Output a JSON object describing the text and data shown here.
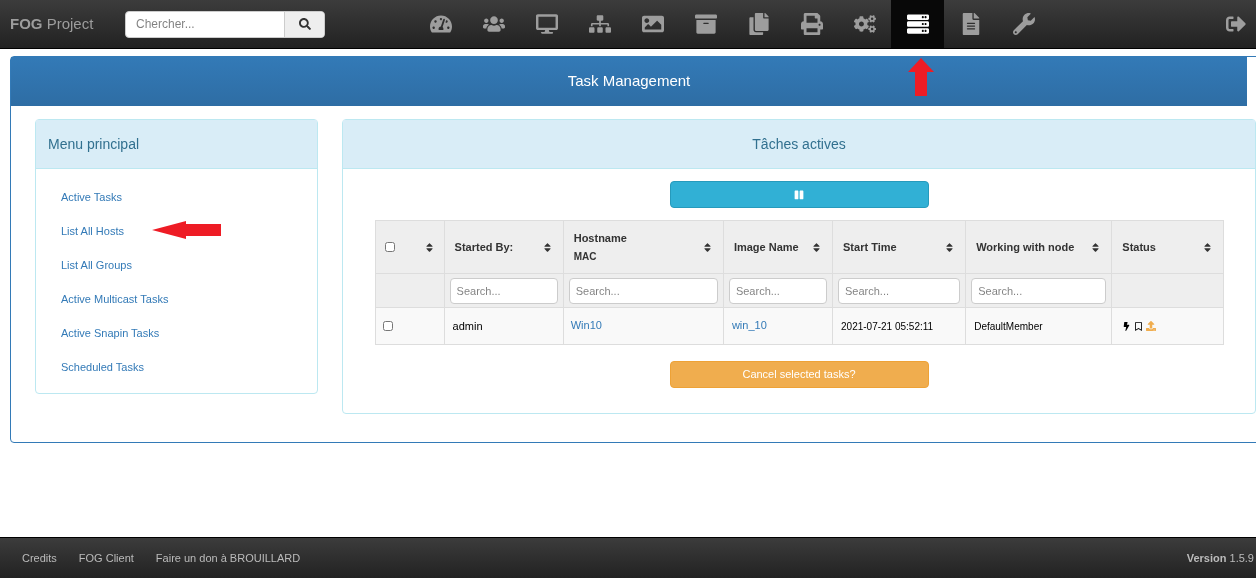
{
  "navbar": {
    "brand": "**FOG** Project",
    "search": {
      "placeholder": "Chercher..."
    },
    "icons": [
      {
        "kind": "dashboard",
        "selected": false
      },
      {
        "kind": "users",
        "selected": false
      },
      {
        "kind": "desktop",
        "selected": false
      },
      {
        "kind": "sitemap",
        "selected": false
      },
      {
        "kind": "image",
        "selected": false
      },
      {
        "kind": "archive",
        "selected": false
      },
      {
        "kind": "copy",
        "selected": false
      },
      {
        "kind": "printer",
        "selected": false
      },
      {
        "kind": "gears",
        "selected": false
      },
      {
        "kind": "tasks",
        "selected": true
      },
      {
        "kind": "file",
        "selected": false
      },
      {
        "kind": "wrench",
        "selected": false
      }
    ]
  },
  "page": {
    "title": "Task Management",
    "menu": {
      "title": "Menu principal",
      "items": [
        "Active Tasks",
        "List All Hosts",
        "List All Groups",
        "Active Multicast Tasks",
        "Active Snapin Tasks",
        "Scheduled Tasks"
      ]
    },
    "tasks": {
      "title": "Tâches actives",
      "select_all": {
        "checked": false
      },
      "columns": [
        {
          "label": "Started By:",
          "placeholder": "Search..."
        },
        {
          "label": "Hostname",
          "sub": "MAC",
          "placeholder": "Search..."
        },
        {
          "label": "Image Name",
          "placeholder": "Search..."
        },
        {
          "label": "Start Time",
          "placeholder": "Search..."
        },
        {
          "label": "Working with node",
          "placeholder": "Search..."
        },
        {
          "label": "Status"
        }
      ],
      "rows": [
        {
          "checked": false,
          "started_by": "admin",
          "hostname": "Win10",
          "image": "win_10",
          "start": "2021-07-21 05:52:11",
          "node": "DefaultMember"
        }
      ],
      "cancel_button": "Cancel selected tasks?"
    }
  },
  "footer": {
    "links": [
      "Credits",
      "FOG Client",
      "Faire un don à BROUILLARD"
    ],
    "version": "**Version** 1.5.9"
  }
}
